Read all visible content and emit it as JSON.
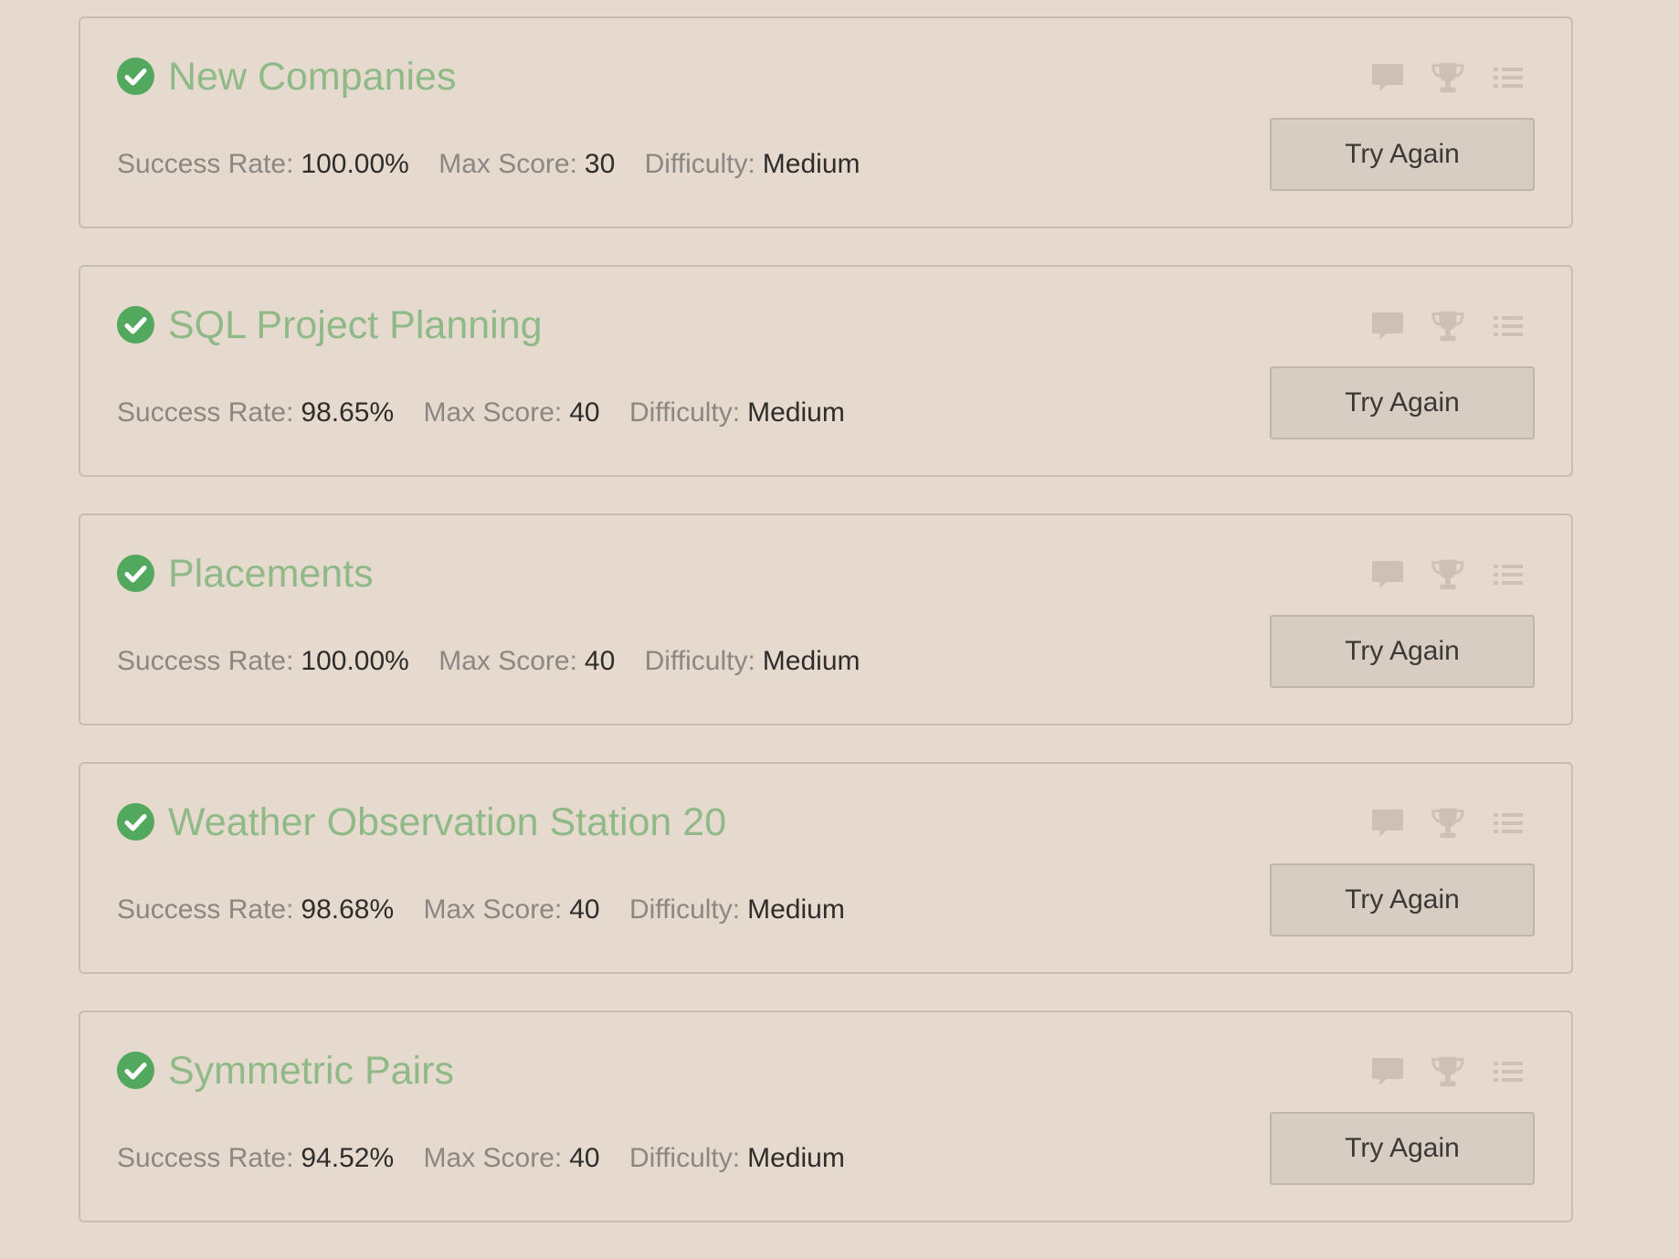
{
  "challenges": [
    {
      "title": "New Companies",
      "success_rate_label": "Success Rate:",
      "success_rate": "100.00%",
      "max_score_label": "Max Score:",
      "max_score": "30",
      "difficulty_label": "Difficulty:",
      "difficulty": "Medium",
      "button_label": "Try Again",
      "solved": true
    },
    {
      "title": "SQL Project Planning",
      "success_rate_label": "Success Rate:",
      "success_rate": "98.65%",
      "max_score_label": "Max Score:",
      "max_score": "40",
      "difficulty_label": "Difficulty:",
      "difficulty": "Medium",
      "button_label": "Try Again",
      "solved": true
    },
    {
      "title": "Placements",
      "success_rate_label": "Success Rate:",
      "success_rate": "100.00%",
      "max_score_label": "Max Score:",
      "max_score": "40",
      "difficulty_label": "Difficulty:",
      "difficulty": "Medium",
      "button_label": "Try Again",
      "solved": true
    },
    {
      "title": "Weather Observation Station 20",
      "success_rate_label": "Success Rate:",
      "success_rate": "98.68%",
      "max_score_label": "Max Score:",
      "max_score": "40",
      "difficulty_label": "Difficulty:",
      "difficulty": "Medium",
      "button_label": "Try Again",
      "solved": true
    },
    {
      "title": "Symmetric Pairs",
      "success_rate_label": "Success Rate:",
      "success_rate": "94.52%",
      "max_score_label": "Max Score:",
      "max_score": "40",
      "difficulty_label": "Difficulty:",
      "difficulty": "Medium",
      "button_label": "Try Again",
      "solved": true
    }
  ],
  "icons": {
    "solved": "check-circle-icon",
    "discussions": "comment-icon",
    "leaderboard": "trophy-icon",
    "submissions": "list-icon"
  },
  "colors": {
    "page_background": "#e6dace",
    "title": "#8fba88",
    "check": "#52a85d",
    "label": "#8c8782",
    "value": "#2f2d2b",
    "icon": "#cdc1b6",
    "button_background": "#d8cdc3"
  }
}
